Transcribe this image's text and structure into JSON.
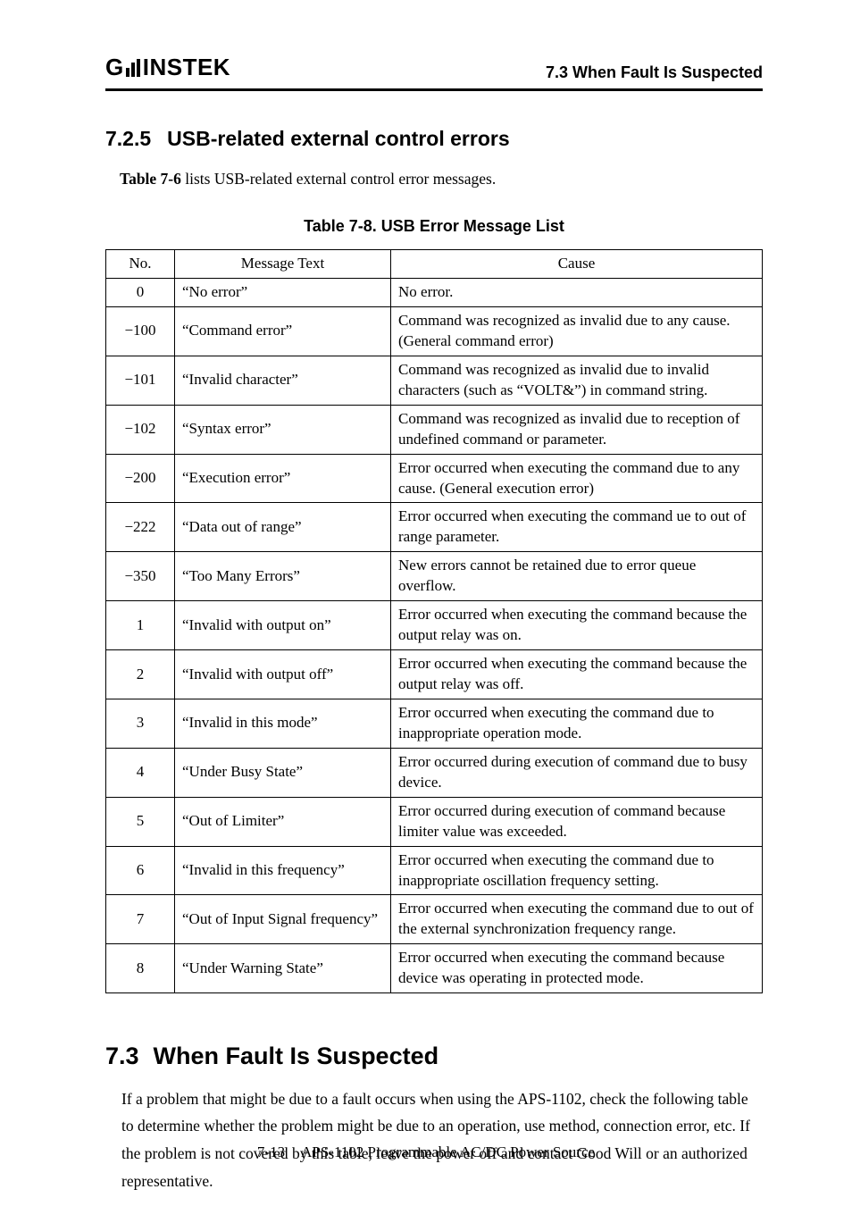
{
  "header": {
    "logo_prefix": "G",
    "logo_suffix": "INSTEK",
    "right": "7.3 When Fault Is Suspected"
  },
  "section725": {
    "number": "7.2.5",
    "title": "USB-related external control errors",
    "intro_prefix": "Table 7-6",
    "intro_rest": " lists USB-related external control error messages.",
    "table_title": "Table 7-8.  USB Error Message List",
    "col_no": "No.",
    "col_msg": "Message Text",
    "col_cause": "Cause",
    "rows": [
      {
        "no": "0",
        "msg": "“No error”",
        "cause": "No error."
      },
      {
        "no": "−100",
        "msg": "“Command error”",
        "cause": "Command was recognized as invalid due to any cause. (General command error)"
      },
      {
        "no": "−101",
        "msg": "“Invalid character”",
        "cause": "Command was recognized as invalid due to invalid characters (such as “VOLT&”) in command string."
      },
      {
        "no": "−102",
        "msg": "“Syntax error”",
        "cause": "Command was recognized as invalid due to reception of undefined command or parameter."
      },
      {
        "no": "−200",
        "msg": "“Execution error”",
        "cause": "Error occurred when executing the command due to any cause. (General execution error)"
      },
      {
        "no": "−222",
        "msg": "“Data out of range”",
        "cause": "Error occurred when executing the command ue to out of range parameter."
      },
      {
        "no": "−350",
        "msg": "“Too Many Errors”",
        "cause": "New errors cannot be retained due to error queue overflow."
      },
      {
        "no": "1",
        "msg": "“Invalid with output on”",
        "cause": "Error occurred when executing the command because the output relay was on."
      },
      {
        "no": "2",
        "msg": "“Invalid with output off”",
        "cause": "Error occurred when executing the command because the output relay was off."
      },
      {
        "no": "3",
        "msg": "“Invalid in this mode”",
        "cause": "Error occurred when executing the command due to inappropriate operation mode."
      },
      {
        "no": "4",
        "msg": "“Under Busy State”",
        "cause": "Error occurred during execution of command due to busy device."
      },
      {
        "no": "5",
        "msg": "“Out of Limiter”",
        "cause": "Error occurred during execution of command because limiter value was exceeded."
      },
      {
        "no": "6",
        "msg": "“Invalid in this frequency”",
        "cause": "Error occurred when executing the command due to inappropriate oscillation frequency setting."
      },
      {
        "no": "7",
        "msg": "“Out of Input Signal frequency”",
        "cause": "Error occurred when executing the command due to out of the external synchronization frequency range."
      },
      {
        "no": "8",
        "msg": "“Under Warning State”",
        "cause": "Error occurred when executing the command because device was operating in protected mode."
      }
    ]
  },
  "section73": {
    "number": "7.3",
    "title": "When Fault Is Suspected",
    "para": "If a problem that might be due to a fault occurs when using the APS-1102, check the following table to determine whether the problem might be due to an operation, use method, connection error, etc. If the problem is not covered by this table, leave the power off and contact Good Will or an authorized representative."
  },
  "footer": {
    "page": "7-13",
    "doc": "APS-1102 Programmable AC/DC Power Source"
  }
}
